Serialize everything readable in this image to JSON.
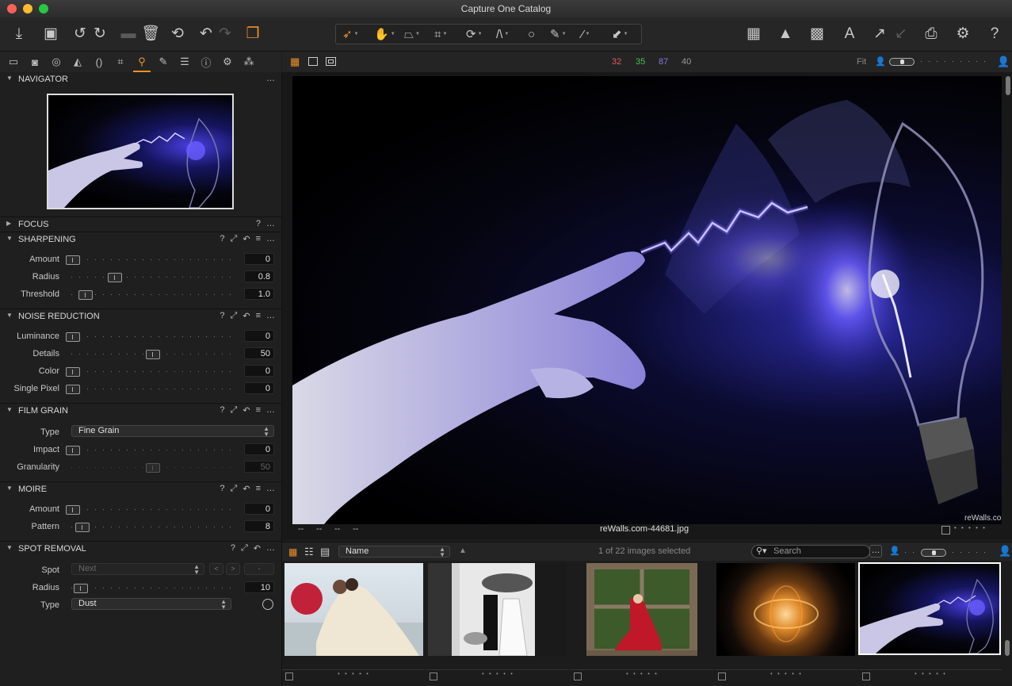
{
  "window": {
    "title": "Capture One Catalog"
  },
  "viewer_bar": {
    "counts": [
      {
        "value": "32",
        "color": "#e05a5a"
      },
      {
        "value": "35",
        "color": "#4fbf4f"
      },
      {
        "value": "87",
        "color": "#8a78e0"
      },
      {
        "value": "40",
        "color": "#9a9a9a"
      }
    ],
    "zoom_label": "Fit"
  },
  "navigator": {
    "title": "NAVIGATOR",
    "menu": "…"
  },
  "focus": {
    "title": "FOCUS",
    "help": "?",
    "menu": "…"
  },
  "sharpening": {
    "title": "SHARPENING",
    "rows": [
      {
        "label": "Amount",
        "value": "0",
        "level": 0.0
      },
      {
        "label": "Radius",
        "value": "0.8",
        "level": 0.26
      },
      {
        "label": "Threshold",
        "value": "1.0",
        "level": 0.08
      }
    ]
  },
  "noise_reduction": {
    "title": "NOISE REDUCTION",
    "rows": [
      {
        "label": "Luminance",
        "value": "0",
        "level": 0.0
      },
      {
        "label": "Details",
        "value": "50",
        "level": 0.5
      },
      {
        "label": "Color",
        "value": "0",
        "level": 0.0
      },
      {
        "label": "Single Pixel",
        "value": "0",
        "level": 0.0
      }
    ]
  },
  "film_grain": {
    "title": "FILM GRAIN",
    "type_label": "Type",
    "type_value": "Fine Grain",
    "rows": [
      {
        "label": "Impact",
        "value": "0",
        "level": 0.0
      },
      {
        "label": "Granularity",
        "value": "50",
        "level": 0.5
      }
    ]
  },
  "moire": {
    "title": "MOIRE",
    "rows": [
      {
        "label": "Amount",
        "value": "0",
        "level": 0.0
      },
      {
        "label": "Pattern",
        "value": "8",
        "level": 0.06
      }
    ]
  },
  "spot_removal": {
    "title": "SPOT REMOVAL",
    "spot_label": "Spot",
    "spot_value": "Next",
    "prev": "<",
    "next": ">",
    "dash": "-",
    "radius_label": "Radius",
    "radius_value": "10",
    "radius_level": 0.05,
    "type_label": "Type",
    "type_value": "Dust"
  },
  "viewer": {
    "filename": "reWalls.com-44681.jpg",
    "watermark": "reWalls.com",
    "left_meta": [
      "--",
      "--",
      "--",
      "--"
    ]
  },
  "browser": {
    "sort_value": "Name",
    "selection_text": "1 of 22 images selected",
    "search_placeholder": "Search",
    "dots": "• • • • •"
  },
  "colors": {
    "accent": "#f0902a",
    "panel": "#1f1f1f",
    "toolbar": "#262626"
  }
}
